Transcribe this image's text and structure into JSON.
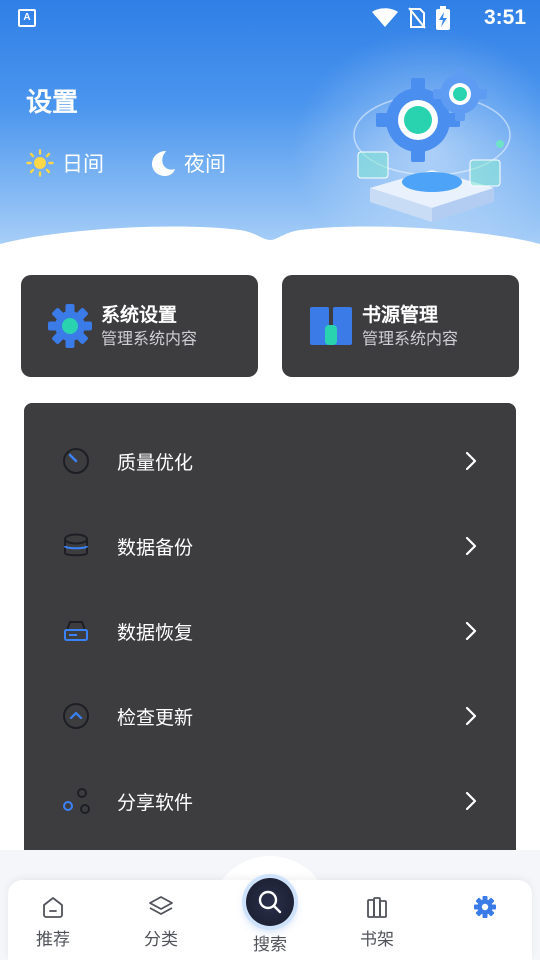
{
  "status_bar": {
    "time": "3:51",
    "left_icon_letter": "A"
  },
  "header": {
    "title": "设置"
  },
  "modes": [
    {
      "label": "日间",
      "icon": "sun-icon"
    },
    {
      "label": "夜间",
      "icon": "moon-icon"
    }
  ],
  "cards": [
    {
      "title": "系统设置",
      "subtitle": "管理系统内容",
      "icon": "gear-icon"
    },
    {
      "title": "书源管理",
      "subtitle": "管理系统内容",
      "icon": "book-source-icon"
    }
  ],
  "menu": [
    {
      "label": "质量优化",
      "icon": "speedometer-icon"
    },
    {
      "label": "数据备份",
      "icon": "database-icon"
    },
    {
      "label": "数据恢复",
      "icon": "drive-icon"
    },
    {
      "label": "检查更新",
      "icon": "update-icon"
    },
    {
      "label": "分享软件",
      "icon": "share-icon"
    }
  ],
  "nav": [
    {
      "label": "推荐",
      "icon": "home-icon"
    },
    {
      "label": "分类",
      "icon": "layers-icon"
    },
    {
      "label": "搜索",
      "icon": "search-icon"
    },
    {
      "label": "书架",
      "icon": "bookshelf-icon"
    },
    {
      "label": "",
      "icon": "settings-icon",
      "active": true
    }
  ],
  "colors": {
    "accent": "#2f7fe6",
    "card_bg": "#3d3d40",
    "icon_blue": "#3b82f6"
  }
}
